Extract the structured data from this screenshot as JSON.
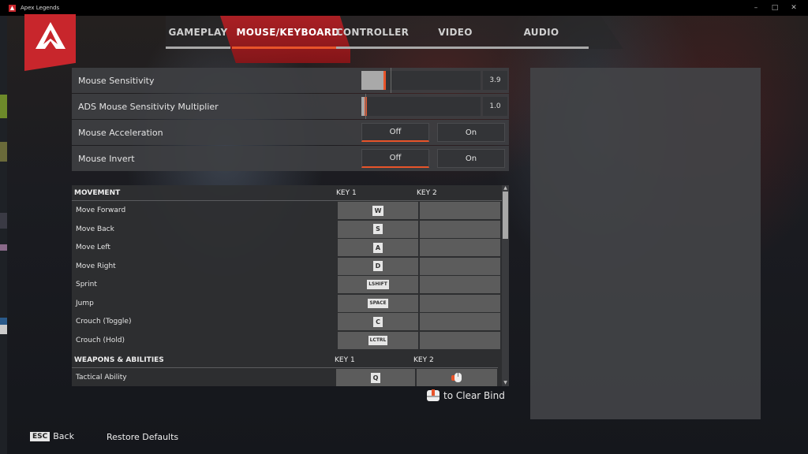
{
  "window": {
    "title": "Apex Legends",
    "controls": [
      "minimize",
      "maximize",
      "close"
    ]
  },
  "tabs": [
    {
      "label": "GAMEPLAY",
      "active": false
    },
    {
      "label": "MOUSE/KEYBOARD",
      "active": true
    },
    {
      "label": "CONTROLLER",
      "active": false
    },
    {
      "label": "VIDEO",
      "active": false
    },
    {
      "label": "AUDIO",
      "active": false
    }
  ],
  "settings": {
    "mouse_sensitivity": {
      "label": "Mouse Sensitivity",
      "value": "3.9",
      "fraction": 0.1
    },
    "ads_multiplier": {
      "label": "ADS Mouse Sensitivity Multiplier",
      "value": "1.0",
      "fraction": 0.0
    },
    "mouse_acceleration": {
      "label": "Mouse Acceleration",
      "off": "Off",
      "on": "On",
      "selected": "Off"
    },
    "mouse_invert": {
      "label": "Mouse Invert",
      "off": "Off",
      "on": "On",
      "selected": "Off"
    }
  },
  "keybinds": {
    "sections": [
      {
        "title": "MOVEMENT",
        "key1_header": "KEY 1",
        "key2_header": "KEY 2",
        "rows": [
          {
            "action": "Move Forward",
            "key1": "W",
            "key2": ""
          },
          {
            "action": "Move Back",
            "key1": "S",
            "key2": ""
          },
          {
            "action": "Move Left",
            "key1": "A",
            "key2": ""
          },
          {
            "action": "Move Right",
            "key1": "D",
            "key2": ""
          },
          {
            "action": "Sprint",
            "key1": "LSHIFT",
            "key2": ""
          },
          {
            "action": "Jump",
            "key1": "SPACE",
            "key2": ""
          },
          {
            "action": "Crouch (Toggle)",
            "key1": "C",
            "key2": ""
          },
          {
            "action": "Crouch (Hold)",
            "key1": "LCTRL",
            "key2": ""
          }
        ]
      },
      {
        "title": "WEAPONS & ABILITIES",
        "key1_header": "KEY 1",
        "key2_header": "KEY 2",
        "rows": [
          {
            "action": "Tactical Ability",
            "key1": "Q",
            "key2": "mouse-button-4-icon"
          }
        ]
      }
    ]
  },
  "hints": {
    "clear_bind": "to Clear Bind"
  },
  "footer": {
    "esc_key": "ESC",
    "back": "Back",
    "restore_defaults": "Restore Defaults"
  },
  "colors": {
    "accent": "#e8542a",
    "brand_red": "#c8262c"
  }
}
